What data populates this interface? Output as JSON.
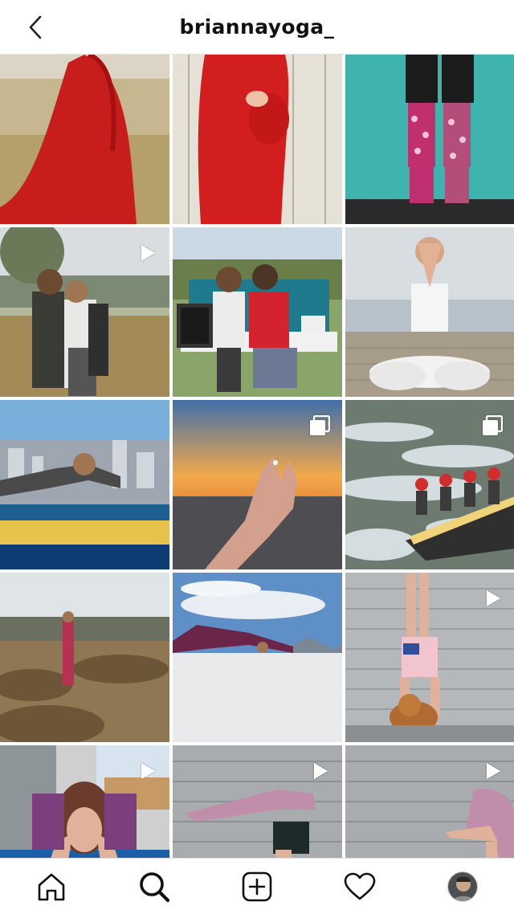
{
  "header": {
    "username": "briannayoga_"
  },
  "icons": {
    "back": "chevron-left-icon",
    "video": "play-icon",
    "carousel": "multiple-posts-icon",
    "home": "home-icon",
    "search": "search-icon",
    "new_post": "add-post-icon",
    "activity": "heart-icon",
    "profile": "avatar"
  },
  "posts": [
    {
      "type": "photo"
    },
    {
      "type": "photo"
    },
    {
      "type": "photo"
    },
    {
      "type": "video"
    },
    {
      "type": "photo"
    },
    {
      "type": "photo"
    },
    {
      "type": "photo"
    },
    {
      "type": "carousel"
    },
    {
      "type": "carousel"
    },
    {
      "type": "photo"
    },
    {
      "type": "photo"
    },
    {
      "type": "video"
    },
    {
      "type": "video"
    },
    {
      "type": "video"
    },
    {
      "type": "video"
    }
  ]
}
